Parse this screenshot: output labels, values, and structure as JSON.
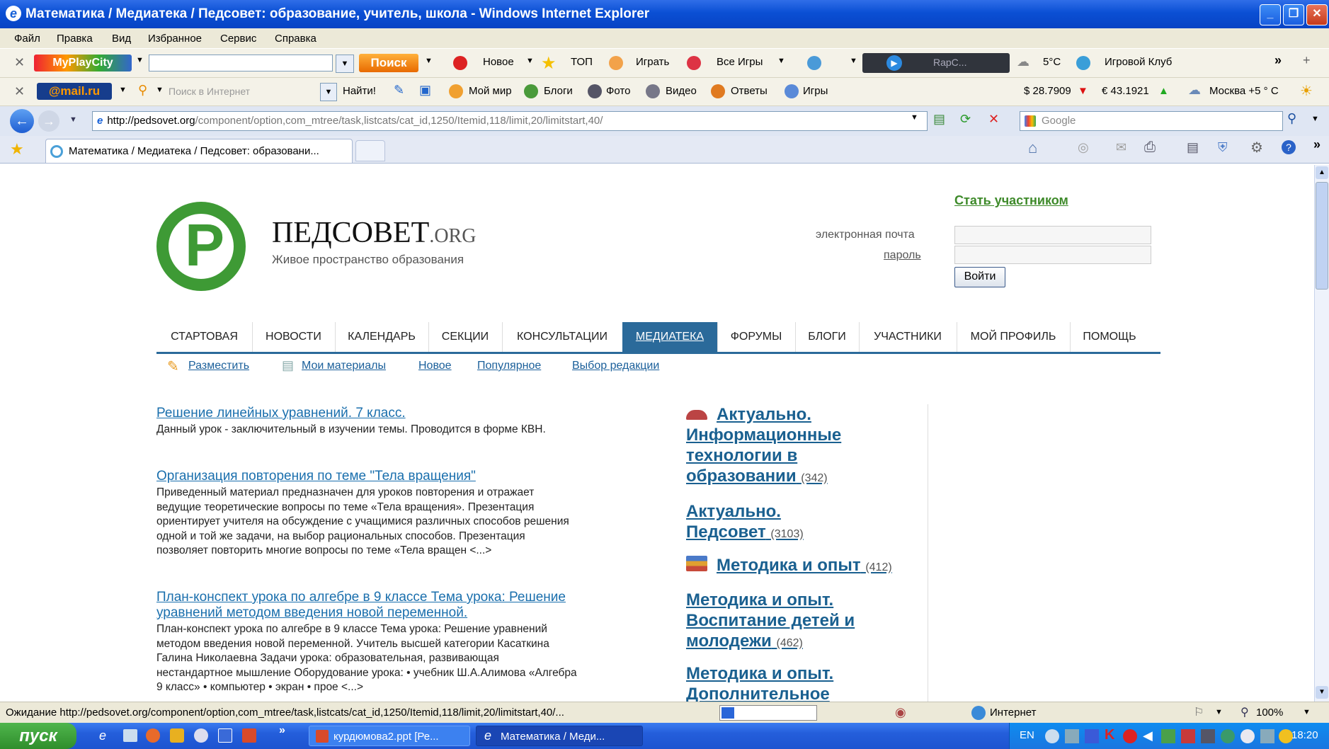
{
  "window": {
    "title": "Математика / Медиатека / Педсовет: образование, учитель, школа - Windows Internet Explorer"
  },
  "menu": [
    "Файл",
    "Правка",
    "Вид",
    "Избранное",
    "Сервис",
    "Справка"
  ],
  "toolbar1": {
    "brand": "MyPlayCity",
    "search_button": "Поиск",
    "items": [
      "Новое",
      "ТОП",
      "Играть",
      "Все Игры"
    ],
    "player_text": "RapC...",
    "weather": "5°C",
    "club": "Игровой Клуб"
  },
  "toolbar2": {
    "brand": "@mail.ru",
    "search_placeholder": "Поиск в Интернет",
    "find_button": "Найти!",
    "items": [
      "Мой мир",
      "Блоги",
      "Фото",
      "Видео",
      "Ответы",
      "Игры"
    ],
    "usd": "$ 28.7909",
    "eur": "€ 43.1921",
    "city_weather": "Москва +5 ° C"
  },
  "address": {
    "url_domain": "http://pedsovet.org",
    "url_path": "/component/option,com_mtree/task,listcats/cat_id,1250/Itemid,118/limit,20/limitstart,40/",
    "search_placeholder": "Google"
  },
  "tab": {
    "label": "Математика / Медиатека / Педсовет: образовани..."
  },
  "site": {
    "logo_name": "ПЕДСОВЕТ",
    "logo_suffix": ".ORG",
    "tagline": "Живое пространство образования",
    "join_link": "Стать участником",
    "email_label": "электронная почта",
    "password_label": "пароль",
    "login_button": "Войти"
  },
  "nav": [
    {
      "label": "СТАРТОВАЯ",
      "active": false
    },
    {
      "label": "НОВОСТИ",
      "active": false
    },
    {
      "label": "КАЛЕНДАРЬ",
      "active": false
    },
    {
      "label": "СЕКЦИИ",
      "active": false
    },
    {
      "label": "КОНСУЛЬТАЦИИ",
      "active": false
    },
    {
      "label": "МЕДИАТЕКА",
      "active": true
    },
    {
      "label": "ФОРУМЫ",
      "active": false
    },
    {
      "label": "БЛОГИ",
      "active": false
    },
    {
      "label": "УЧАСТНИКИ",
      "active": false
    },
    {
      "label": "МОЙ ПРОФИЛЬ",
      "active": false
    },
    {
      "label": "ПОМОЩЬ",
      "active": false
    }
  ],
  "subnav": [
    "Разместить",
    "Мои материалы",
    "Новое",
    "Популярное",
    "Выбор редакции"
  ],
  "articles": [
    {
      "title": "Решение линейных уравнений. 7 класс.",
      "lines": [
        "Данный урок - заключительный в изучении темы. Проводится в форме КВН."
      ]
    },
    {
      "title": "Организация повторения по теме \"Тела вращения\"",
      "lines": [
        "Приведенный материал предназначен для уроков повторения и отражает",
        "ведущие теоретические вопросы по теме «Тела вращения». Презентация",
        "ориентирует учителя на обсуждение с учащимися различных способов решения",
        "одной и той же задачи, на выбор рациональных способов. Презентация",
        "позволяет повторить многие вопросы по теме «Тела вращен <...>"
      ]
    },
    {
      "title_lines": [
        "План-конспект урока по алгебре в 9 классе Тема урока: Решение",
        "уравнений методом введения новой переменной."
      ],
      "lines": [
        "План-конспект урока по алгебре в 9 классе Тема урока: Решение уравнений",
        "методом введения новой переменной. Учитель высшей категории Касаткина",
        "Галина Николаевна Задачи урока: образовательная, развивающая",
        "нестандартное мышление Оборудование урока: • учебник Ш.А.Алимова «Алгебра",
        "9 класс» • компьютер • экран • прое <...>"
      ]
    }
  ],
  "categories": [
    {
      "lines": [
        "Актуально.",
        "Информационные",
        "технологии в",
        "образовании"
      ],
      "count": "(342)"
    },
    {
      "lines": [
        "Актуально.",
        "Педсовет"
      ],
      "count": "(3103)"
    },
    {
      "lines": [
        "Методика и опыт"
      ],
      "count": "(412)"
    },
    {
      "lines": [
        "Методика и опыт.",
        "Воспитание детей и",
        "молодежи"
      ],
      "count": "(462)"
    },
    {
      "lines": [
        "Методика и опыт.",
        "Дополнительное"
      ],
      "count": ""
    }
  ],
  "status": {
    "text": "Ожидание http://pedsovet.org/component/option,com_mtree/task,listcats/cat_id,1250/Itemid,118/limit,20/limitstart,40/...",
    "zone": "Интернет",
    "zoom": "100%"
  },
  "taskbar": {
    "start": "пуск",
    "tasks": [
      "курдюмова2.ppt [Ре...",
      "Математика / Меди..."
    ],
    "lang": "EN",
    "clock": "18:20"
  }
}
